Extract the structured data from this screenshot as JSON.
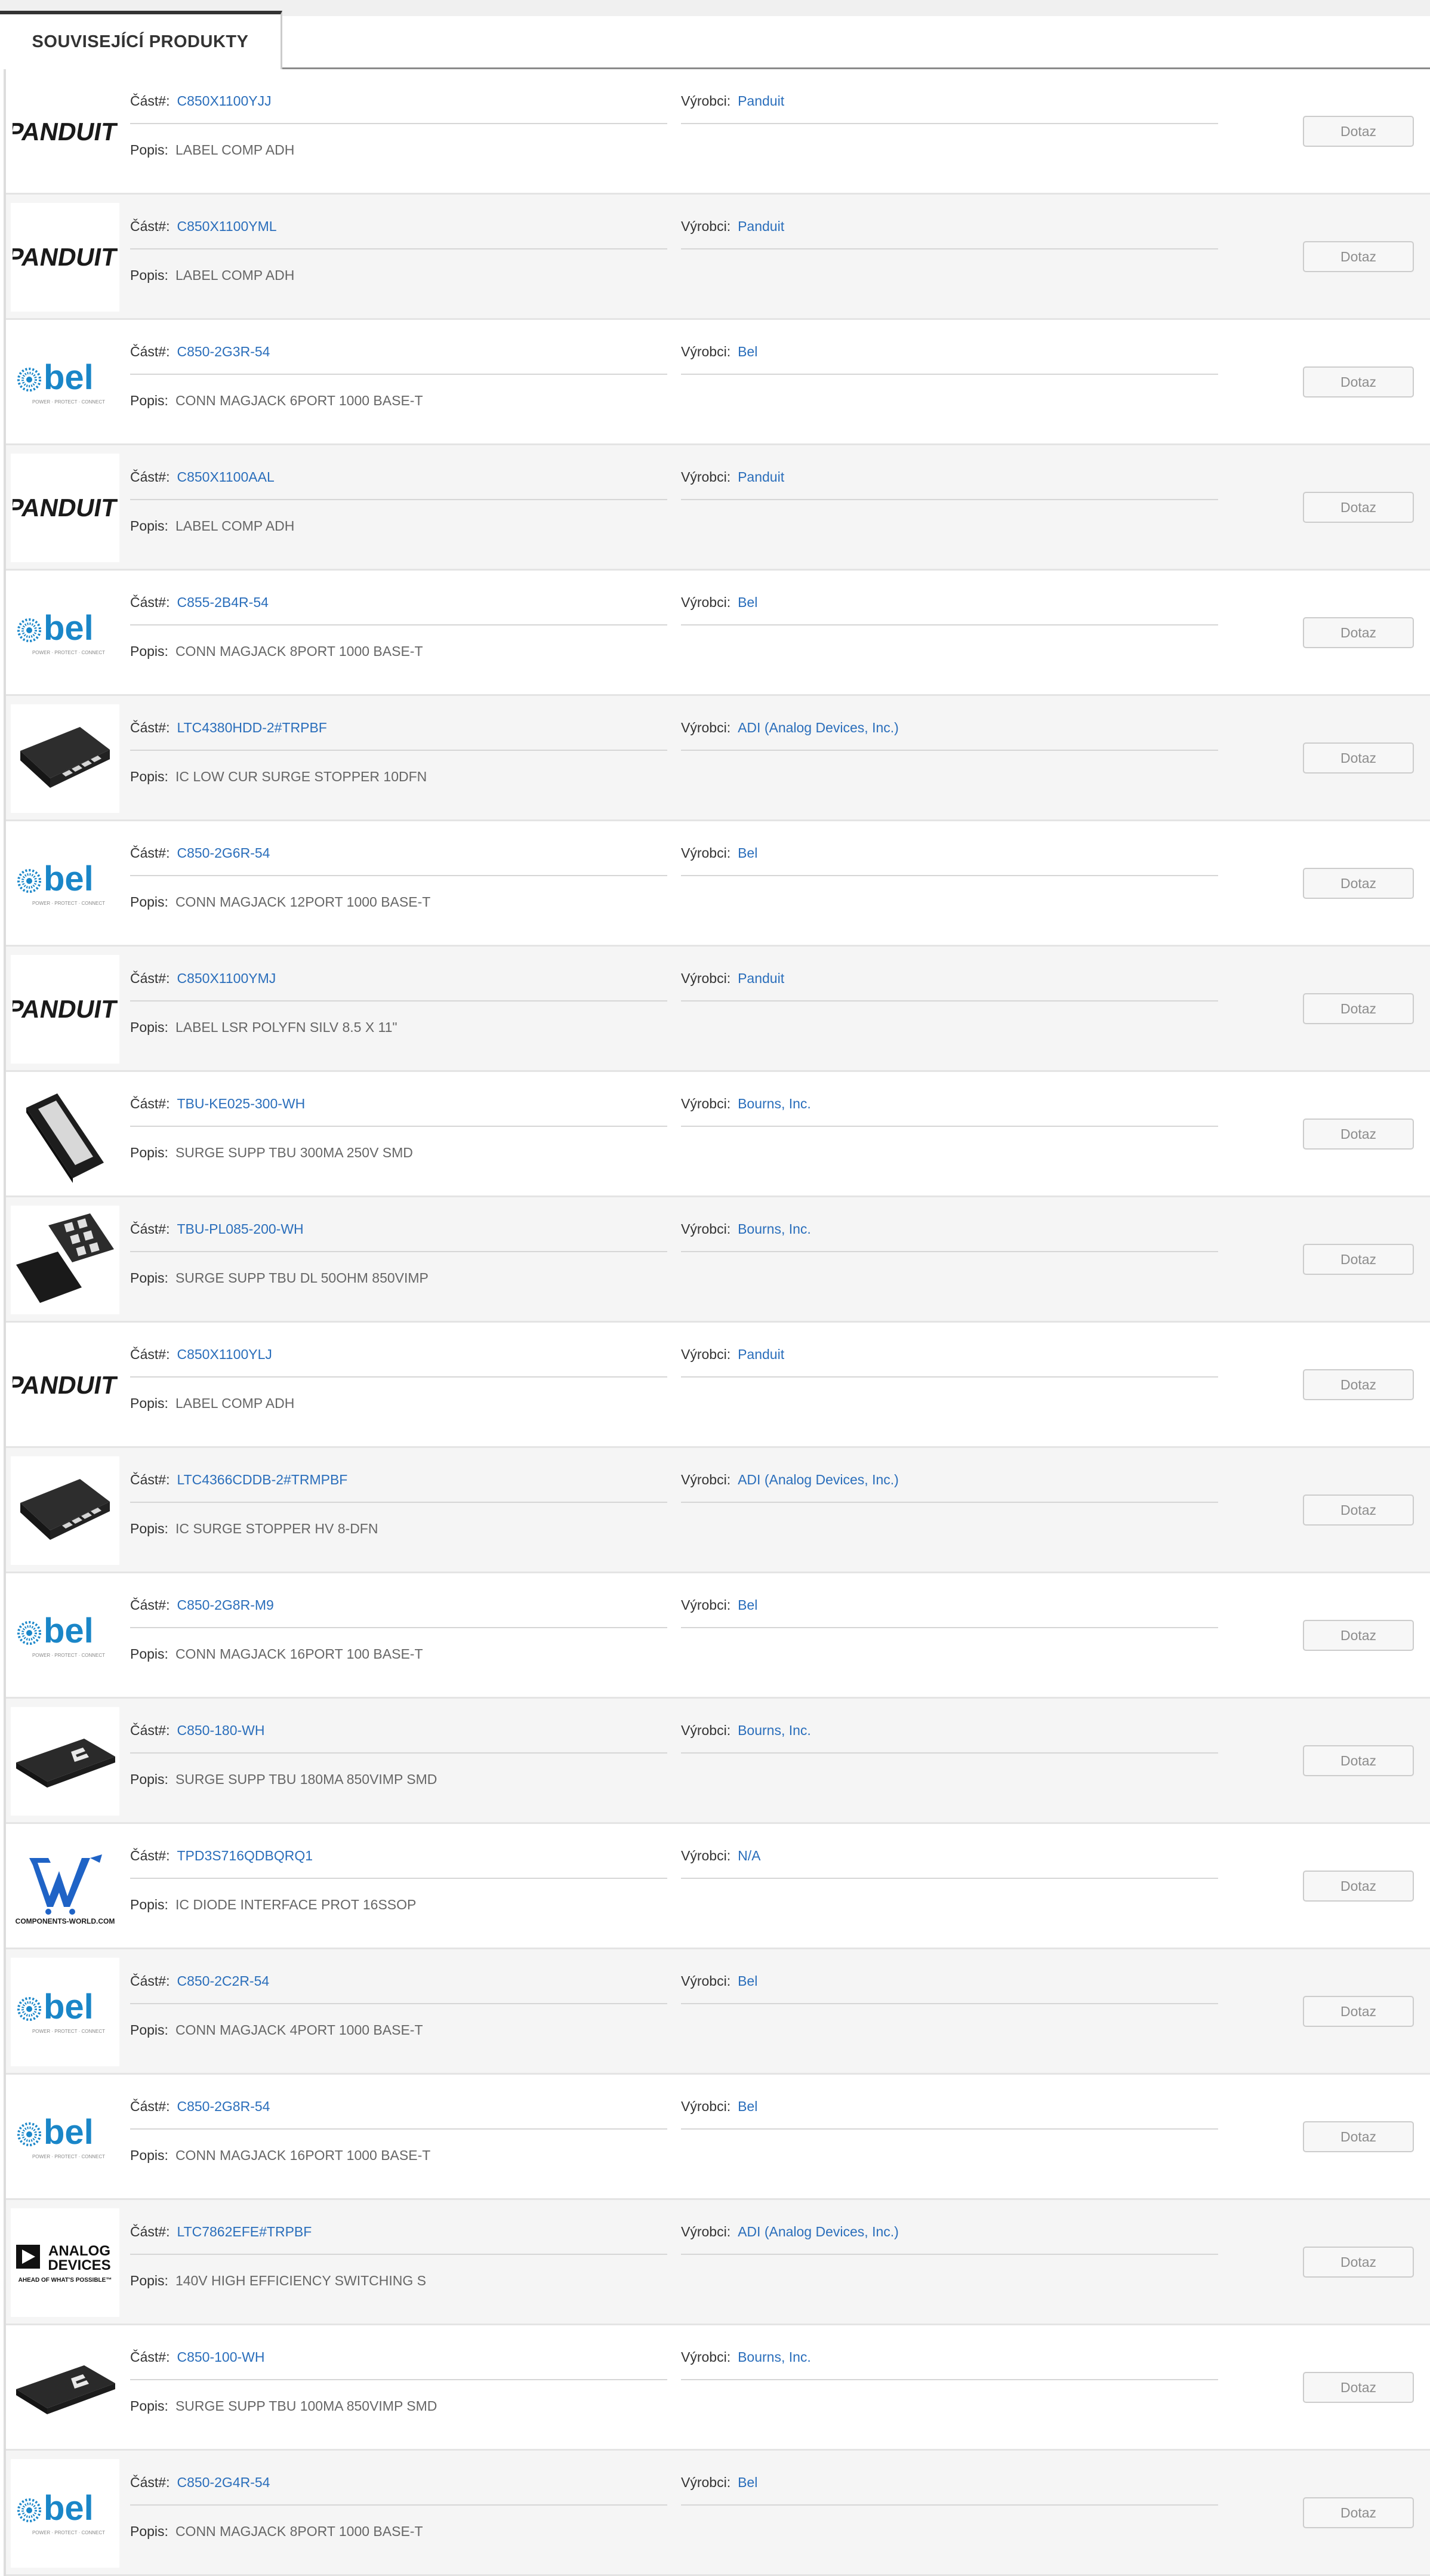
{
  "tab": {
    "label": "SOUVISEJÍCÍ PRODUKTY"
  },
  "labels": {
    "part": "Část#:",
    "manufacturer": "Výrobci:",
    "description": "Popis:"
  },
  "button_label": "Dotaz",
  "colors": {
    "link": "#2a6ebb",
    "bel_blue": "#1a86c8",
    "cw_blue": "#1f63c6"
  },
  "logo_text": {
    "panduit": "PANDUIT",
    "bel": "bel",
    "bel_tag": "POWER · PROTECT · CONNECT",
    "cw": "COMPONENTS-WORLD.COM",
    "adi_1": "ANALOG",
    "adi_2": "DEVICES",
    "adi_3": "AHEAD OF WHAT'S POSSIBLE™"
  },
  "products": [
    {
      "logo": "panduit-logo",
      "part": "C850X1100YJJ",
      "manufacturer": "Panduit",
      "description": "LABEL COMP ADH"
    },
    {
      "logo": "panduit-logo",
      "part": "C850X1100YML",
      "manufacturer": "Panduit",
      "description": "LABEL COMP ADH"
    },
    {
      "logo": "bel-logo",
      "part": "C850-2G3R-54",
      "manufacturer": "Bel",
      "description": "CONN MAGJACK 6PORT 1000 BASE-T"
    },
    {
      "logo": "panduit-logo",
      "part": "C850X1100AAL",
      "manufacturer": "Panduit",
      "description": "LABEL COMP ADH"
    },
    {
      "logo": "bel-logo",
      "part": "C855-2B4R-54",
      "manufacturer": "Bel",
      "description": "CONN MAGJACK 8PORT 1000 BASE-T"
    },
    {
      "logo": "dfn-chip-image",
      "part": "LTC4380HDD-2#TRPBF",
      "manufacturer": "ADI (Analog Devices, Inc.)",
      "description": "IC LOW CUR SURGE STOPPER 10DFN"
    },
    {
      "logo": "bel-logo",
      "part": "C850-2G6R-54",
      "manufacturer": "Bel",
      "description": "CONN MAGJACK 12PORT 1000 BASE-T"
    },
    {
      "logo": "panduit-logo",
      "part": "C850X1100YMJ",
      "manufacturer": "Panduit",
      "description": "LABEL LSR POLYFN SILV 8.5 X 11\""
    },
    {
      "logo": "tbu-chip-image",
      "part": "TBU-KE025-300-WH",
      "manufacturer": "Bourns, Inc.",
      "description": "SURGE SUPP TBU 300MA 250V SMD"
    },
    {
      "logo": "tbu-pad-chip-image",
      "part": "TBU-PL085-200-WH",
      "manufacturer": "Bourns, Inc.",
      "description": "SURGE SUPP TBU DL 50OHM 850VIMP"
    },
    {
      "logo": "panduit-logo",
      "part": "C850X1100YLJ",
      "manufacturer": "Panduit",
      "description": "LABEL COMP ADH"
    },
    {
      "logo": "dfn-chip-image",
      "part": "LTC4366CDDB-2#TRMPBF",
      "manufacturer": "ADI (Analog Devices, Inc.)",
      "description": "IC SURGE STOPPER HV 8-DFN"
    },
    {
      "logo": "bel-logo",
      "part": "C850-2G8R-M9",
      "manufacturer": "Bel",
      "description": "CONN MAGJACK 16PORT 100 BASE-T"
    },
    {
      "logo": "bourns-chip-image",
      "part": "C850-180-WH",
      "manufacturer": "Bourns, Inc.",
      "description": "SURGE SUPP TBU 180MA 850VIMP SMD"
    },
    {
      "logo": "components-world-logo",
      "part": "TPD3S716QDBQRQ1",
      "manufacturer": "N/A",
      "description": "IC DIODE INTERFACE PROT 16SSOP"
    },
    {
      "logo": "bel-logo",
      "part": "C850-2C2R-54",
      "manufacturer": "Bel",
      "description": "CONN MAGJACK 4PORT 1000 BASE-T"
    },
    {
      "logo": "bel-logo",
      "part": "C850-2G8R-54",
      "manufacturer": "Bel",
      "description": "CONN MAGJACK 16PORT 1000 BASE-T"
    },
    {
      "logo": "analog-devices-logo",
      "part": "LTC7862EFE#TRPBF",
      "manufacturer": "ADI (Analog Devices, Inc.)",
      "description": "140V HIGH EFFICIENCY SWITCHING S"
    },
    {
      "logo": "bourns-chip-image",
      "part": "C850-100-WH",
      "manufacturer": "Bourns, Inc.",
      "description": "SURGE SUPP TBU 100MA 850VIMP SMD"
    },
    {
      "logo": "bel-logo",
      "part": "C850-2G4R-54",
      "manufacturer": "Bel",
      "description": "CONN MAGJACK 8PORT 1000 BASE-T"
    }
  ]
}
